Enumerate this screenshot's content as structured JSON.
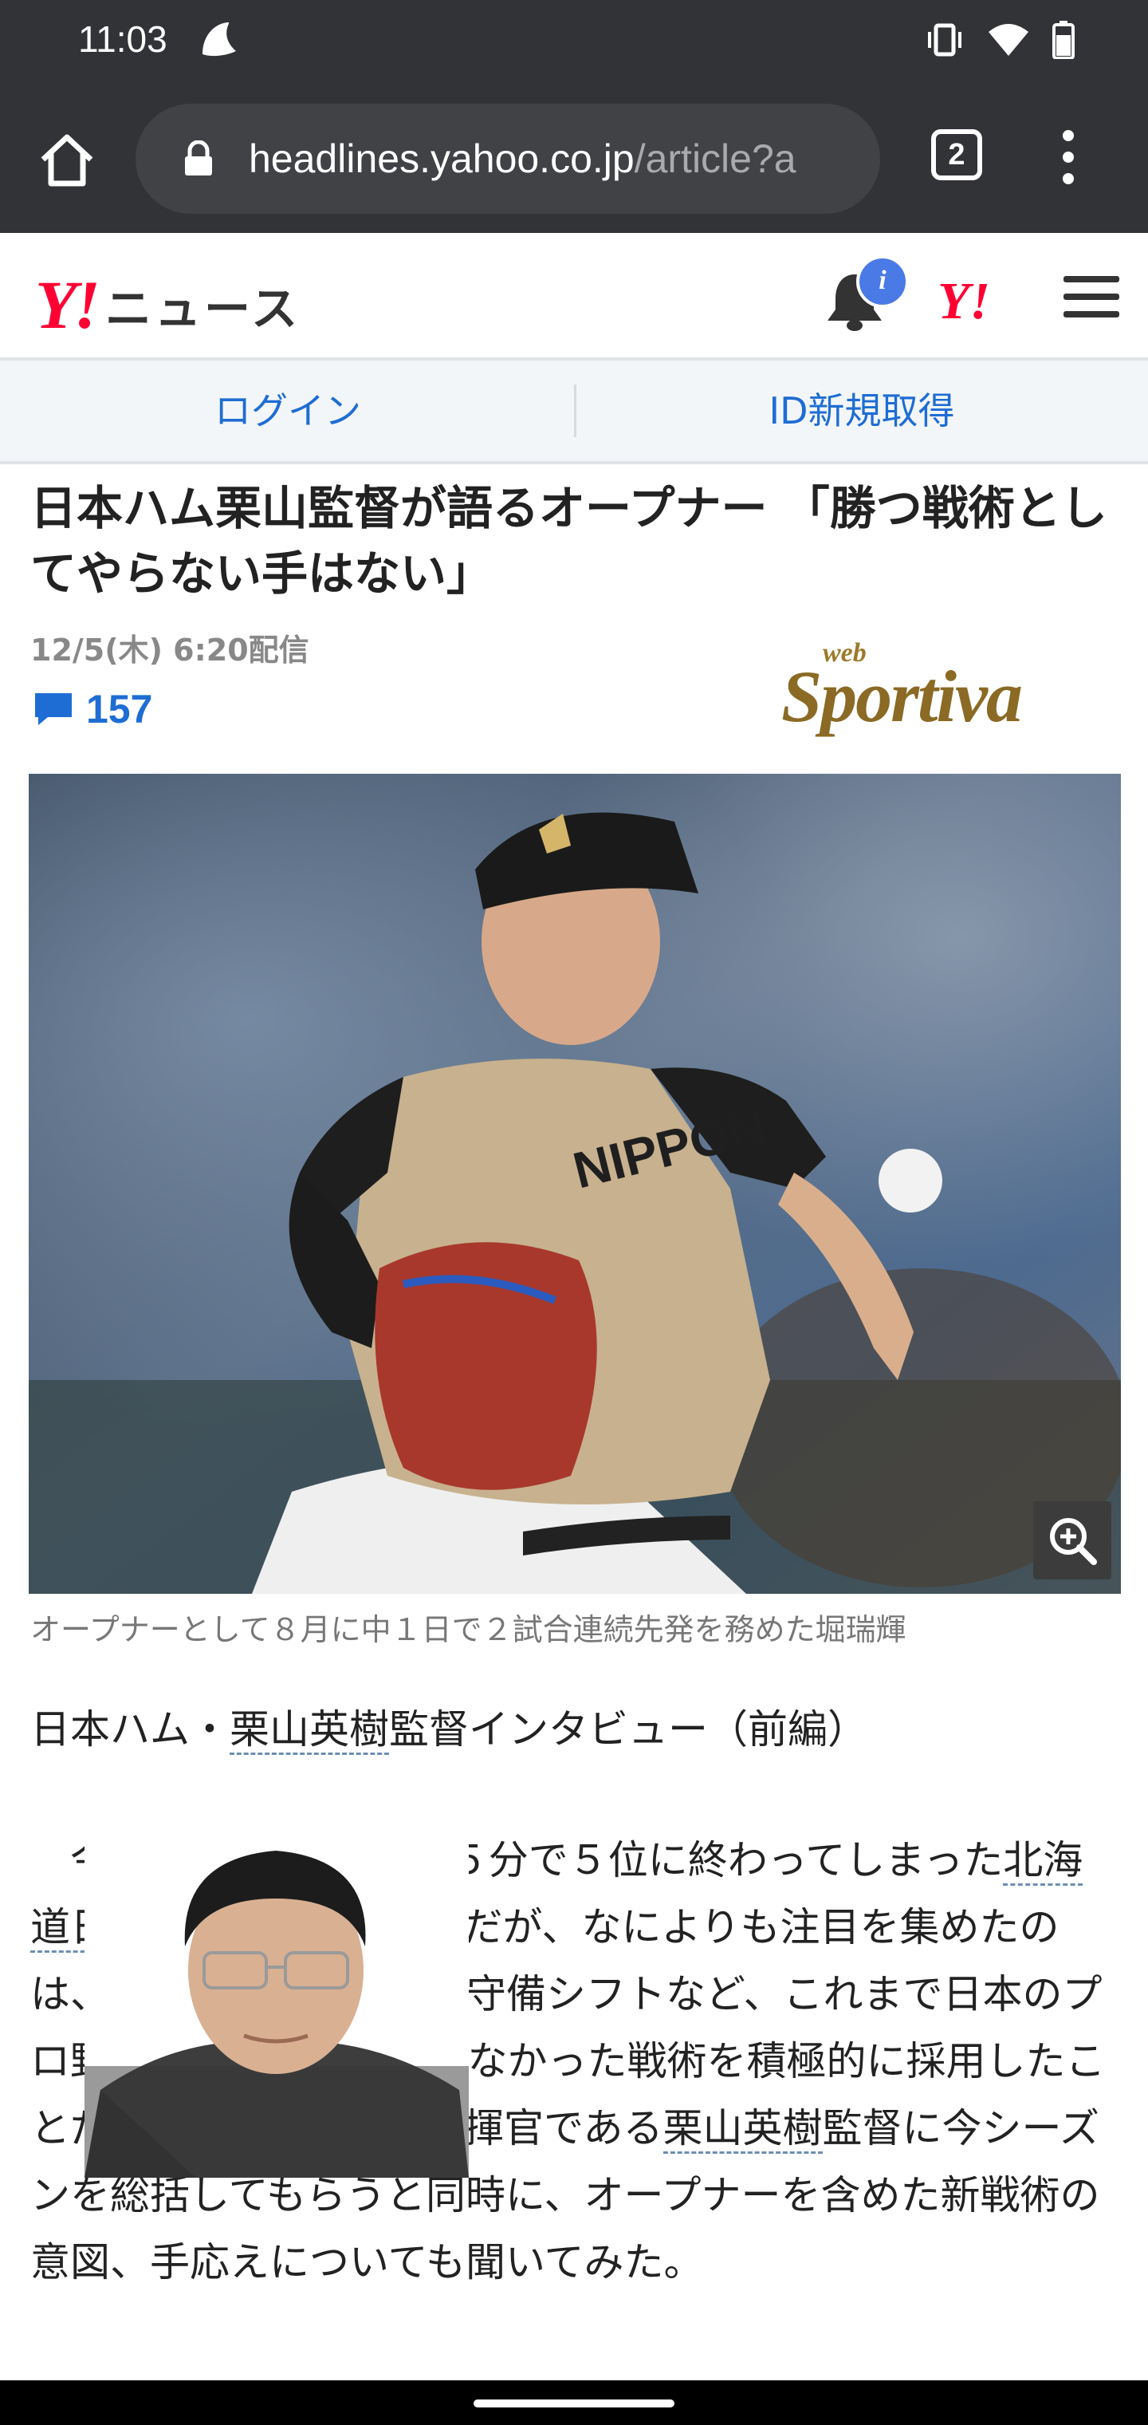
{
  "status": {
    "time": "11:03"
  },
  "browser": {
    "url_host": "headlines.yahoo.co.jp",
    "url_path": "/article?a",
    "tab_count": "2"
  },
  "site": {
    "logo_y": "Y!",
    "logo_news": "ニュース",
    "notification_badge": "i",
    "yahoo_mark": "Y!"
  },
  "account": {
    "login": "ログイン",
    "register": "ID新規取得"
  },
  "article": {
    "headline": "日本ハム栗山監督が語るオープナー 「勝つ戦術としてやらない手はない」",
    "published": "12/5(木) 6:20配信",
    "comment_count": "157",
    "source_web": "web",
    "source_name": "Sportiva",
    "caption": "オープナーとして８月に中１日で２試合連続先発を務めた堀瑞輝",
    "subhead_pre": "日本ハム・",
    "subhead_link": "栗山英樹",
    "subhead_post": "監督インタビュー（前編）",
    "body_1": "　今シーズン65勝73敗５分で５位に終わってしまった",
    "body_link_1": "北海道日本ハムファイターズ",
    "body_2": "だが、なによりも注目を集めたのは、オープナーや極端な守備シフトなど、これまで日本のプロ野球でほとんど目にしなかった戦術を積極的に採用したことだ。ファイターズの指揮官である",
    "body_link_2": "栗山英樹",
    "body_3": "監督に今シーズンを総括してもらうと同時に、オープナーを含めた新戦術の意図、手応えについても聞いてみた。"
  },
  "colors": {
    "chrome": "#323336",
    "brand_red": "#ff0033",
    "link_blue": "#1e6dd4"
  }
}
